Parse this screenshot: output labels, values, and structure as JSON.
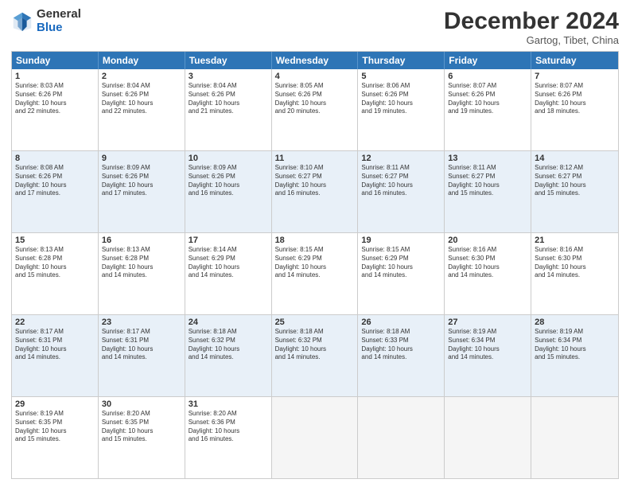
{
  "header": {
    "logo_line1": "General",
    "logo_line2": "Blue",
    "main_title": "December 2024",
    "subtitle": "Gartog, Tibet, China"
  },
  "calendar": {
    "days_of_week": [
      "Sunday",
      "Monday",
      "Tuesday",
      "Wednesday",
      "Thursday",
      "Friday",
      "Saturday"
    ],
    "weeks": [
      [
        {
          "num": "",
          "text": "",
          "empty": true
        },
        {
          "num": "2",
          "text": "Sunrise: 8:04 AM\nSunset: 6:26 PM\nDaylight: 10 hours\nand 22 minutes.",
          "shaded": false
        },
        {
          "num": "3",
          "text": "Sunrise: 8:04 AM\nSunset: 6:26 PM\nDaylight: 10 hours\nand 21 minutes.",
          "shaded": false
        },
        {
          "num": "4",
          "text": "Sunrise: 8:05 AM\nSunset: 6:26 PM\nDaylight: 10 hours\nand 20 minutes.",
          "shaded": false
        },
        {
          "num": "5",
          "text": "Sunrise: 8:06 AM\nSunset: 6:26 PM\nDaylight: 10 hours\nand 19 minutes.",
          "shaded": false
        },
        {
          "num": "6",
          "text": "Sunrise: 8:07 AM\nSunset: 6:26 PM\nDaylight: 10 hours\nand 19 minutes.",
          "shaded": false
        },
        {
          "num": "7",
          "text": "Sunrise: 8:07 AM\nSunset: 6:26 PM\nDaylight: 10 hours\nand 18 minutes.",
          "shaded": false
        }
      ],
      [
        {
          "num": "1",
          "text": "Sunrise: 8:03 AM\nSunset: 6:26 PM\nDaylight: 10 hours\nand 22 minutes.",
          "shaded": true
        },
        {
          "num": "9",
          "text": "Sunrise: 8:09 AM\nSunset: 6:26 PM\nDaylight: 10 hours\nand 17 minutes.",
          "shaded": true
        },
        {
          "num": "10",
          "text": "Sunrise: 8:09 AM\nSunset: 6:26 PM\nDaylight: 10 hours\nand 16 minutes.",
          "shaded": true
        },
        {
          "num": "11",
          "text": "Sunrise: 8:10 AM\nSunset: 6:27 PM\nDaylight: 10 hours\nand 16 minutes.",
          "shaded": true
        },
        {
          "num": "12",
          "text": "Sunrise: 8:11 AM\nSunset: 6:27 PM\nDaylight: 10 hours\nand 16 minutes.",
          "shaded": true
        },
        {
          "num": "13",
          "text": "Sunrise: 8:11 AM\nSunset: 6:27 PM\nDaylight: 10 hours\nand 15 minutes.",
          "shaded": true
        },
        {
          "num": "14",
          "text": "Sunrise: 8:12 AM\nSunset: 6:27 PM\nDaylight: 10 hours\nand 15 minutes.",
          "shaded": true
        }
      ],
      [
        {
          "num": "8",
          "text": "Sunrise: 8:08 AM\nSunset: 6:26 PM\nDaylight: 10 hours\nand 17 minutes.",
          "shaded": false
        },
        {
          "num": "16",
          "text": "Sunrise: 8:13 AM\nSunset: 6:28 PM\nDaylight: 10 hours\nand 14 minutes.",
          "shaded": false
        },
        {
          "num": "17",
          "text": "Sunrise: 8:14 AM\nSunset: 6:29 PM\nDaylight: 10 hours\nand 14 minutes.",
          "shaded": false
        },
        {
          "num": "18",
          "text": "Sunrise: 8:15 AM\nSunset: 6:29 PM\nDaylight: 10 hours\nand 14 minutes.",
          "shaded": false
        },
        {
          "num": "19",
          "text": "Sunrise: 8:15 AM\nSunset: 6:29 PM\nDaylight: 10 hours\nand 14 minutes.",
          "shaded": false
        },
        {
          "num": "20",
          "text": "Sunrise: 8:16 AM\nSunset: 6:30 PM\nDaylight: 10 hours\nand 14 minutes.",
          "shaded": false
        },
        {
          "num": "21",
          "text": "Sunrise: 8:16 AM\nSunset: 6:30 PM\nDaylight: 10 hours\nand 14 minutes.",
          "shaded": false
        }
      ],
      [
        {
          "num": "15",
          "text": "Sunrise: 8:13 AM\nSunset: 6:28 PM\nDaylight: 10 hours\nand 15 minutes.",
          "shaded": true
        },
        {
          "num": "23",
          "text": "Sunrise: 8:17 AM\nSunset: 6:31 PM\nDaylight: 10 hours\nand 14 minutes.",
          "shaded": true
        },
        {
          "num": "24",
          "text": "Sunrise: 8:18 AM\nSunset: 6:32 PM\nDaylight: 10 hours\nand 14 minutes.",
          "shaded": true
        },
        {
          "num": "25",
          "text": "Sunrise: 8:18 AM\nSunset: 6:32 PM\nDaylight: 10 hours\nand 14 minutes.",
          "shaded": true
        },
        {
          "num": "26",
          "text": "Sunrise: 8:18 AM\nSunset: 6:33 PM\nDaylight: 10 hours\nand 14 minutes.",
          "shaded": true
        },
        {
          "num": "27",
          "text": "Sunrise: 8:19 AM\nSunset: 6:34 PM\nDaylight: 10 hours\nand 14 minutes.",
          "shaded": true
        },
        {
          "num": "28",
          "text": "Sunrise: 8:19 AM\nSunset: 6:34 PM\nDaylight: 10 hours\nand 15 minutes.",
          "shaded": true
        }
      ],
      [
        {
          "num": "22",
          "text": "Sunrise: 8:17 AM\nSunset: 6:31 PM\nDaylight: 10 hours\nand 14 minutes.",
          "shaded": false
        },
        {
          "num": "30",
          "text": "Sunrise: 8:20 AM\nSunset: 6:35 PM\nDaylight: 10 hours\nand 15 minutes.",
          "shaded": false
        },
        {
          "num": "31",
          "text": "Sunrise: 8:20 AM\nSunset: 6:36 PM\nDaylight: 10 hours\nand 16 minutes.",
          "shaded": false
        },
        {
          "num": "",
          "text": "",
          "empty": true
        },
        {
          "num": "",
          "text": "",
          "empty": true
        },
        {
          "num": "",
          "text": "",
          "empty": true
        },
        {
          "num": "",
          "text": "",
          "empty": true
        }
      ],
      [
        {
          "num": "29",
          "text": "Sunrise: 8:19 AM\nSunset: 6:35 PM\nDaylight: 10 hours\nand 15 minutes.",
          "shaded": false
        },
        {
          "num": "",
          "text": "",
          "empty": false
        },
        {
          "num": "",
          "text": "",
          "empty": false
        },
        {
          "num": "",
          "text": "",
          "empty": false
        },
        {
          "num": "",
          "text": "",
          "empty": false
        },
        {
          "num": "",
          "text": "",
          "empty": false
        },
        {
          "num": "",
          "text": "",
          "empty": false
        }
      ]
    ]
  }
}
